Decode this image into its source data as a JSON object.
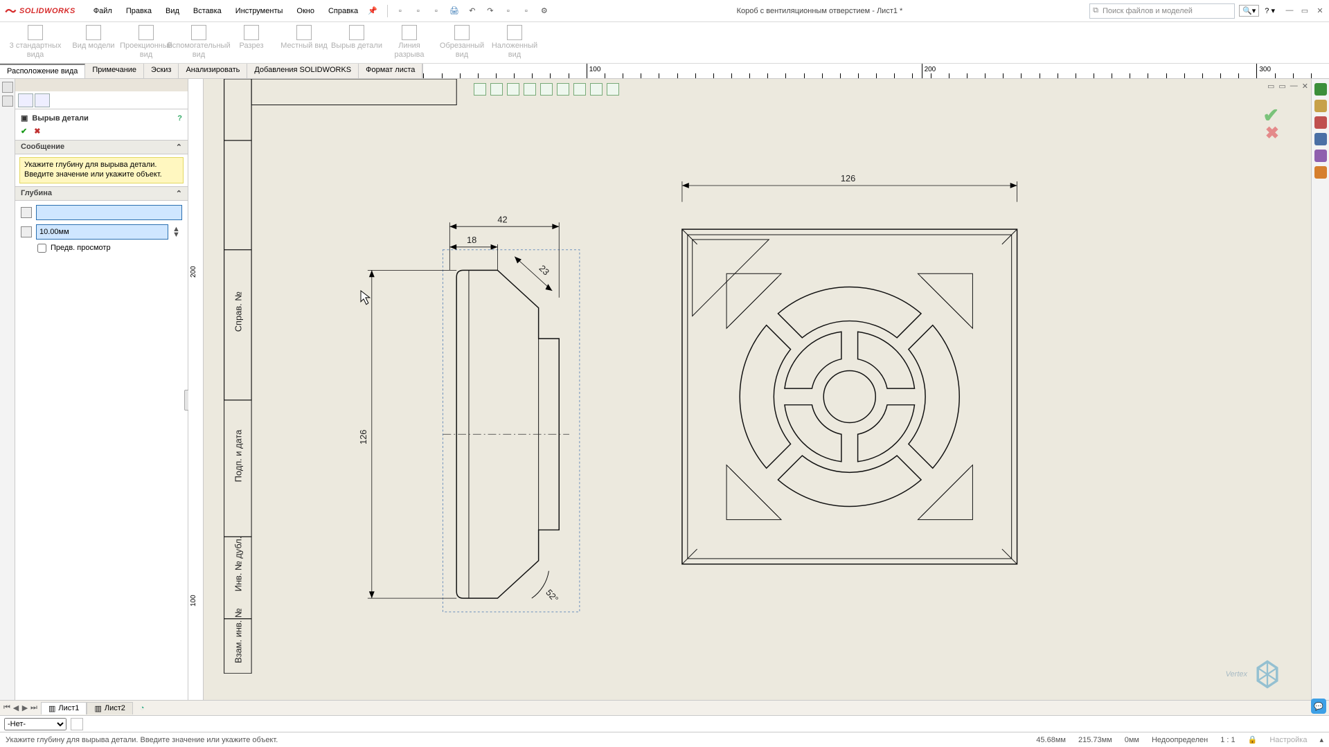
{
  "app": {
    "name": "SOLIDWORKS"
  },
  "menubar": [
    "Файл",
    "Правка",
    "Вид",
    "Вставка",
    "Инструменты",
    "Окно",
    "Справка"
  ],
  "doc_title": "Короб с вентиляционным отверстием - Лист1 *",
  "search_placeholder": "Поиск файлов и моделей",
  "ribbon": [
    "3 стандартных вида",
    "Вид модели",
    "Проекционный вид",
    "Вспомогательный вид",
    "Разрез",
    "Местный вид",
    "Вырыв детали",
    "Линия разрыва",
    "Обрезанный вид",
    "Наложенный вид"
  ],
  "tabs": [
    "Расположение вида",
    "Примечание",
    "Эскиз",
    "Анализировать",
    "Добавления SOLIDWORKS",
    "Формат листа"
  ],
  "h_ruler": [
    {
      "pos_pct": 18,
      "label": "100"
    },
    {
      "pos_pct": 55,
      "label": "200"
    },
    {
      "pos_pct": 92,
      "label": "300"
    }
  ],
  "v_ruler": [
    {
      "pos_pct": 32,
      "label": "200"
    },
    {
      "pos_pct": 85,
      "label": "100"
    }
  ],
  "pm": {
    "title": "Вырыв детали",
    "msg_header": "Сообщение",
    "message": "Укажите глубину для вырыва детали. Введите значение или укажите объект.",
    "depth_header": "Глубина",
    "depth_value": "10.00мм",
    "preview_label": "Предв. просмотр"
  },
  "dimensions": {
    "left_width_outer": "42",
    "left_width_inner": "18",
    "left_height": "126",
    "left_chamfer_len": "23",
    "left_chamfer_ang": "52°",
    "right_width": "126"
  },
  "titleblock": [
    "Справ. №",
    "Подп. и дата",
    "Инв. № дубл.",
    "Взам. инв. №"
  ],
  "watermark": "Vertex",
  "sheets": [
    "Лист1",
    "Лист2"
  ],
  "layer": {
    "options": [
      "-Нет-"
    ],
    "selected": "-Нет-"
  },
  "status": {
    "hint": "Укажите глубину для вырыва детали. Введите значение или укажите объект.",
    "x": "45.68мм",
    "y": "215.73мм",
    "z": "0мм",
    "state": "Недоопределен",
    "scale": "1 : 1",
    "custom": "Настройка"
  },
  "rtool_colors": [
    "#3b8f3b",
    "#c7a14a",
    "#c05050",
    "#4a6fa5",
    "#8f5fae",
    "#d67f2e"
  ]
}
